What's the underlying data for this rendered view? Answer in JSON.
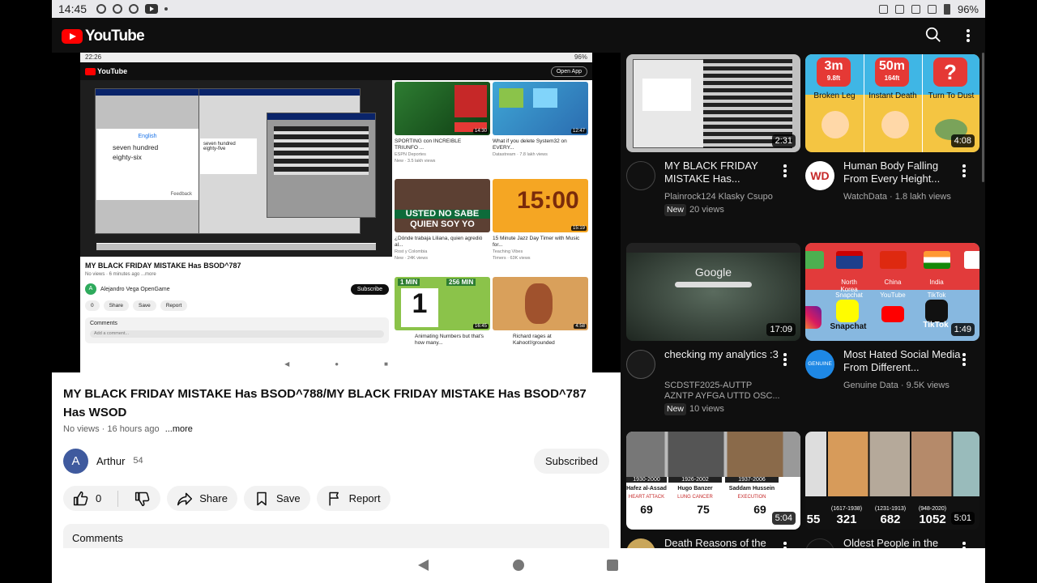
{
  "status_bar": {
    "time": "14:45",
    "battery": "96%"
  },
  "app": {
    "logo_text": "YouTube"
  },
  "embedded": {
    "status_time": "22:26",
    "status_battery": "96%",
    "open_app": "Open App",
    "translate_lang": "English",
    "translate_text_1": "seven hundred",
    "translate_text_2": "eighty-six",
    "translate_feedback": "Feedback",
    "mini_text_1": "seven hundred",
    "mini_text_2": "eighty-five",
    "video_title": "MY BLACK FRIDAY MISTAKE Has BSOD^787",
    "video_meta": "No views · 6 minutes ago ...more",
    "channel": "Alejandro Vega OpenGame",
    "subscribe": "Subscribe",
    "like": "0",
    "share": "Share",
    "save": "Save",
    "report": "Report",
    "comments": "Comments",
    "add_comment": "Add a comment...",
    "side": [
      {
        "title": "SPORTING con INCREIBLE TRIUNFO ...",
        "sub": "ESPN Deportes",
        "meta": "New · 3.5 lakh views",
        "dur": "14:30"
      },
      {
        "title": "What if you delete System32 on EVERY...",
        "sub": "Datastream · 7.8 lakh views",
        "meta": "",
        "dur": "12:47"
      },
      {
        "title": "¿Dónde trabaja Liliana, quien agredió al...",
        "sub": "Rost y Colombia",
        "meta": "New · 24K views",
        "dur": "",
        "overlay_1": "USTED NO SABE",
        "overlay_2": "QUIEN SOY YO"
      },
      {
        "title": "15 Minute Jazz Day Timer with Music for...",
        "sub": "Teaching Vibes",
        "meta": "Timers · 63K views",
        "dur": "15:19",
        "overlay": "15:00"
      },
      {
        "title": "Animating Numbers but that's how many...",
        "sub": "",
        "meta": "",
        "dur": "16:45",
        "label_a": "1 MIN",
        "label_b": "256 MIN",
        "big": "1"
      },
      {
        "title": "Richard rages at Kahoot!/grounded",
        "sub": "",
        "meta": "",
        "dur": "4:58"
      }
    ]
  },
  "video": {
    "title": "MY BLACK FRIDAY MISTAKE Has BSOD^788/MY BLACK FRIDAY MISTAKE Has BSOD^787 Has WSOD",
    "meta": "No views · 16 hours ago",
    "more": "...more",
    "channel_initial": "A",
    "channel_name": "Arthur",
    "subscriber_count": "54",
    "subscribed_label": "Subscribed",
    "like_count": "0",
    "share_label": "Share",
    "save_label": "Save",
    "report_label": "Report",
    "comments_label": "Comments"
  },
  "feed": [
    {
      "title": "MY BLACK FRIDAY MISTAKE Has...",
      "meta_1": "Plainrock124 Klasky Csupo",
      "badge": "New",
      "meta_2": "20 views",
      "duration": "2:31"
    },
    {
      "title": "Human Body Falling From Every Height...",
      "meta_1": "WatchData · 1.8 lakh views",
      "badge": "",
      "meta_2": "",
      "duration": "4:08",
      "labels": [
        "Broken Leg",
        "Instant Death",
        "Turn To Dust"
      ],
      "heights": [
        "3m",
        "50m",
        "?"
      ],
      "heights_ft": [
        "9.8ft",
        "164ft",
        ""
      ],
      "channel_logo": "WD"
    },
    {
      "title": "checking my analytics :3",
      "meta_1": "SCDSTF2025-AUTTP AZNTP AYFGA UTTD OSC...",
      "badge": "New",
      "meta_2": "10 views",
      "duration": "17:09",
      "thumb_text": "Google"
    },
    {
      "title": "Most Hated Social Media From Different...",
      "meta_1": "Genuine Data · 9.5K views",
      "badge": "",
      "meta_2": "",
      "duration": "1:49",
      "countries": [
        "North Korea",
        "China",
        "India"
      ],
      "apps": [
        "Snapchat",
        "YouTube",
        "TikTok"
      ],
      "big_label_1": "Snapchat",
      "big_label_2": "TikTok",
      "channel_logo": "GENUINE"
    },
    {
      "title": "Death Reasons of the",
      "meta_1": "",
      "badge": "",
      "meta_2": "",
      "duration": "5:04",
      "people": [
        "Hafez al-Assad",
        "Hugo Banzer",
        "Saddam Hussein"
      ],
      "years": [
        "1930-2000",
        "1926-2002",
        "1937-2006"
      ],
      "ages": [
        "69",
        "75",
        "69"
      ],
      "causes": [
        "HEART ATTACK",
        "LUNG CANCER",
        "EXECUTION"
      ]
    },
    {
      "title": "Oldest People in the",
      "meta_1": "",
      "badge": "",
      "meta_2": "",
      "duration": "5:01",
      "values": [
        "55",
        "321",
        "682",
        "1052"
      ],
      "ranges": [
        "(1617-1938)",
        "(1231-1913)",
        "(948-2020)"
      ]
    }
  ]
}
